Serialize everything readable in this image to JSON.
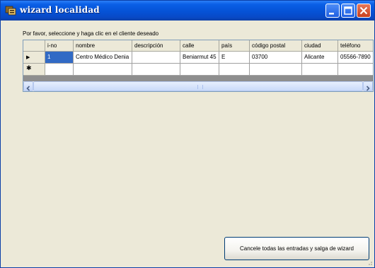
{
  "window": {
    "title": "wizard localidad"
  },
  "prompt": "Por favor, seleccione y haga clic en el cliente deseado",
  "grid": {
    "columns": [
      "i-no",
      "nombre",
      "descripción",
      "calle",
      "país",
      "código postal",
      "ciudad",
      "teléfono"
    ],
    "rows": [
      [
        "1",
        "Centro Médico Denia",
        "",
        "Beniarmut 45",
        "E",
        "03700",
        "Alicante",
        "05566-7890"
      ]
    ],
    "current_row_marker": "▶",
    "new_row_marker": "✱"
  },
  "cancel_button": "Cancele todas las entradas y salga de wizard",
  "colors": {
    "titlebar": "#0552d6",
    "selection": "#316ac5",
    "background": "#ece9d8"
  }
}
